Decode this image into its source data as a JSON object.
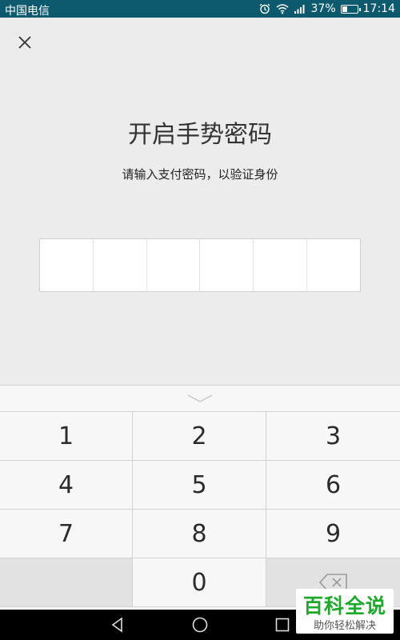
{
  "status_bar": {
    "carrier": "中国电信",
    "battery": "37%",
    "battery_level": 0.37,
    "time": "17:14"
  },
  "page": {
    "title": "开启手势密码",
    "subtitle": "请输入支付密码，以验证身份"
  },
  "pin": {
    "length": 6,
    "entered": 0
  },
  "keypad": {
    "keys": [
      "1",
      "2",
      "3",
      "4",
      "5",
      "6",
      "7",
      "8",
      "9",
      "",
      "0",
      "delete"
    ]
  },
  "watermark": {
    "main": "百科全说",
    "sub": "助你轻松解决"
  }
}
